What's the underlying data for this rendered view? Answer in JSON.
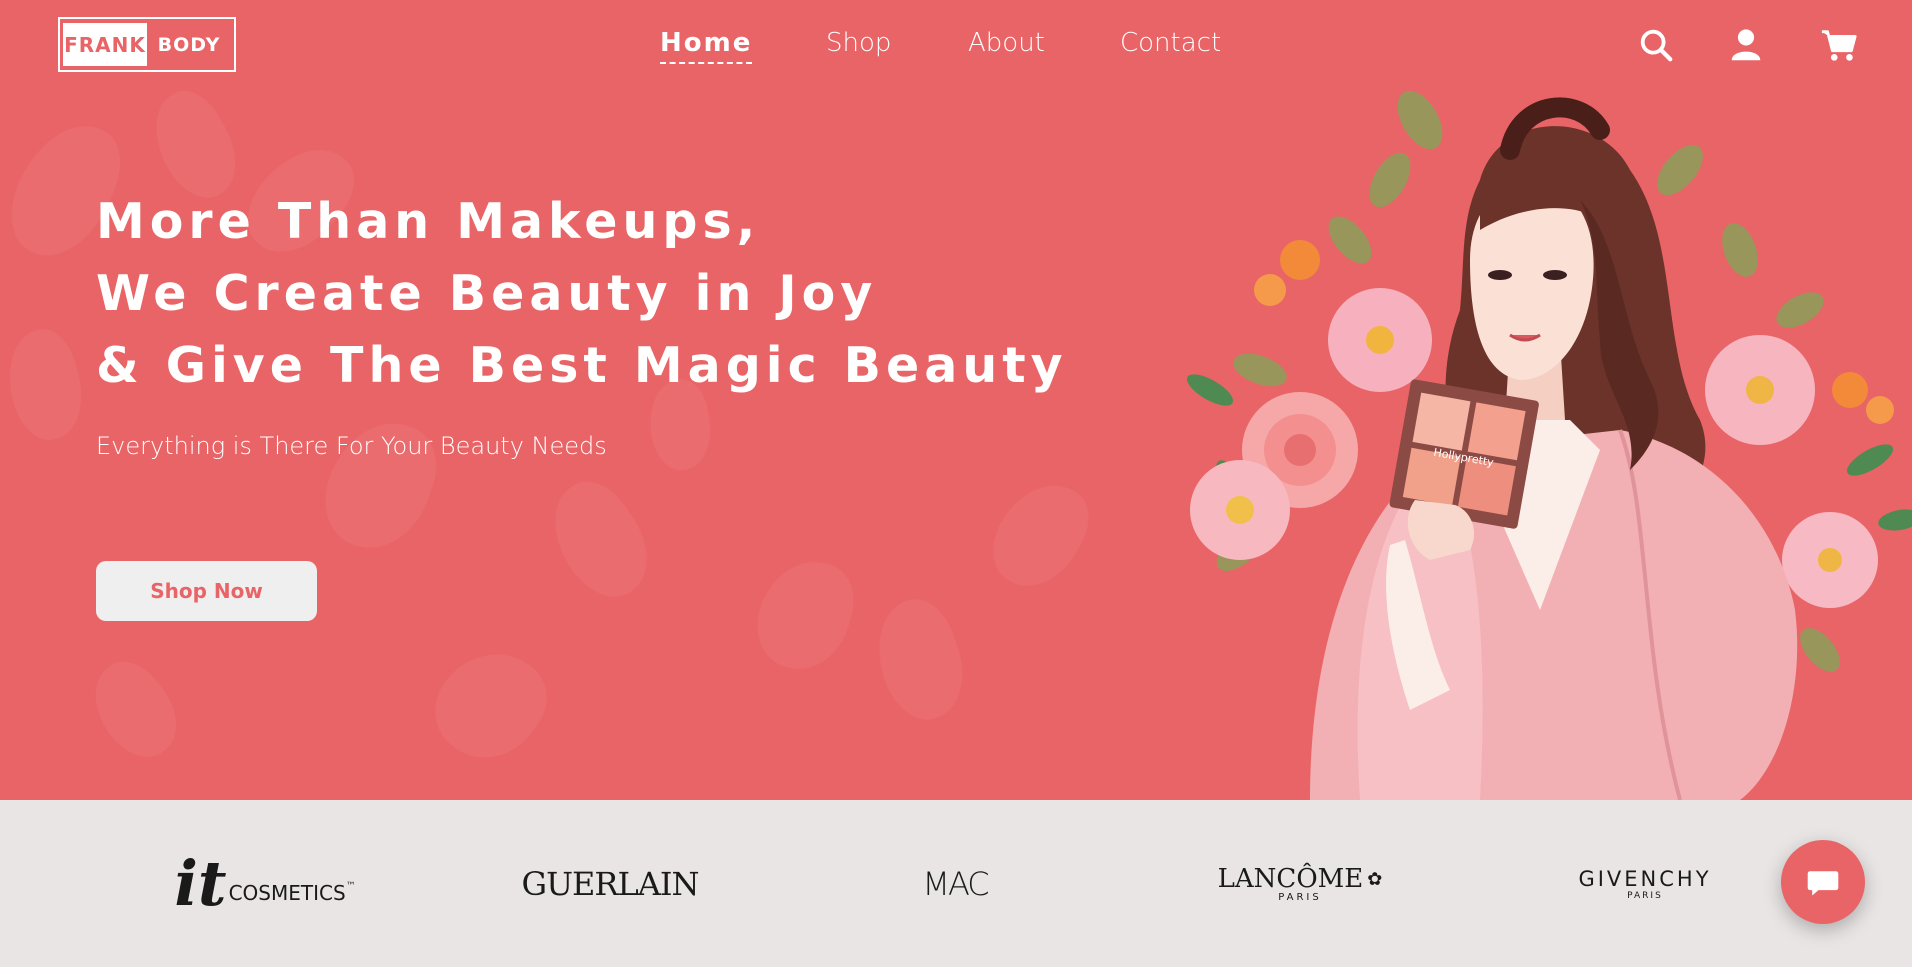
{
  "header": {
    "logo_left": "FRANK",
    "logo_right": "BODY",
    "nav": [
      {
        "label": "Home",
        "active": true
      },
      {
        "label": "Shop",
        "active": false
      },
      {
        "label": "About",
        "active": false
      },
      {
        "label": "Contact",
        "active": false
      }
    ],
    "icons": [
      "search-icon",
      "user-icon",
      "cart-icon"
    ]
  },
  "hero": {
    "headline_lines": [
      "More Than Makeups,",
      "We Create Beauty in Joy",
      "& Give The Best Magic Beauty"
    ],
    "subtext": "Everything is There For Your Beauty Needs",
    "cta_label": "Shop Now",
    "palette_label": "Hollypretty"
  },
  "brands": {
    "it_main": "it",
    "it_sub": "COSMETICS",
    "it_tm": "™",
    "guerlain": "GUERLAIN",
    "mac": "MAC",
    "lancome": "LANCÔME",
    "lancome_sub": "PARIS",
    "givenchy": "GIVENCHY",
    "givenchy_sub": "PARIS"
  },
  "chat": {
    "icon": "chat-bubble-icon"
  },
  "colors": {
    "accent": "#e96466",
    "button_bg": "#efefef",
    "brand_bar_bg": "#e8e5e4",
    "text_light": "#ffffff"
  }
}
